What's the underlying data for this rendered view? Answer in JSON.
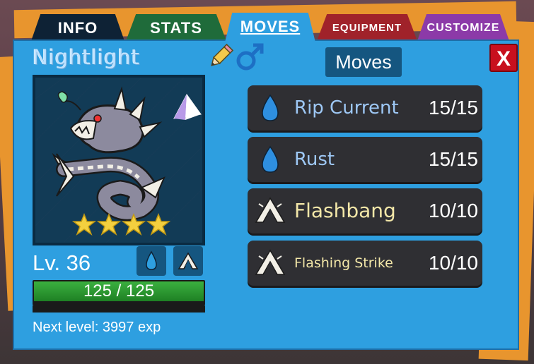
{
  "tabs": [
    {
      "label": "INFO"
    },
    {
      "label": "STATS"
    },
    {
      "label": "MOVES"
    },
    {
      "label": "EQUIPMENT"
    },
    {
      "label": "CUSTOMIZE"
    }
  ],
  "active_tab": "MOVES",
  "pet": {
    "name": "Nightlight",
    "gender_icon": "male-symbol-icon",
    "stars": 4,
    "level_text": "Lv. 36",
    "types": [
      "water-drop-icon",
      "light-icon"
    ],
    "hp_text": "125 / 125",
    "hp_fraction": 1.0,
    "next_level_text": "Next level: 3997 exp"
  },
  "moves_panel": {
    "title": "Moves",
    "close_label": "X",
    "moves": [
      {
        "name": "Rip Current",
        "pp": "15/15",
        "type_icon": "water-drop-icon"
      },
      {
        "name": "Rust",
        "pp": "15/15",
        "type_icon": "water-drop-icon"
      },
      {
        "name": "Flashbang",
        "pp": "10/10",
        "type_icon": "light-icon"
      },
      {
        "name": "Flashing Strike",
        "pp": "10/10",
        "type_icon": "light-icon"
      }
    ]
  },
  "colors": {
    "panel": "#2e9fe0",
    "card": "#2f2f33",
    "water_text": "#9ec8f5",
    "light_text": "#f3e7a8",
    "close": "#c8101e",
    "hp": "#3bb03f",
    "star": "#f4d03f"
  }
}
